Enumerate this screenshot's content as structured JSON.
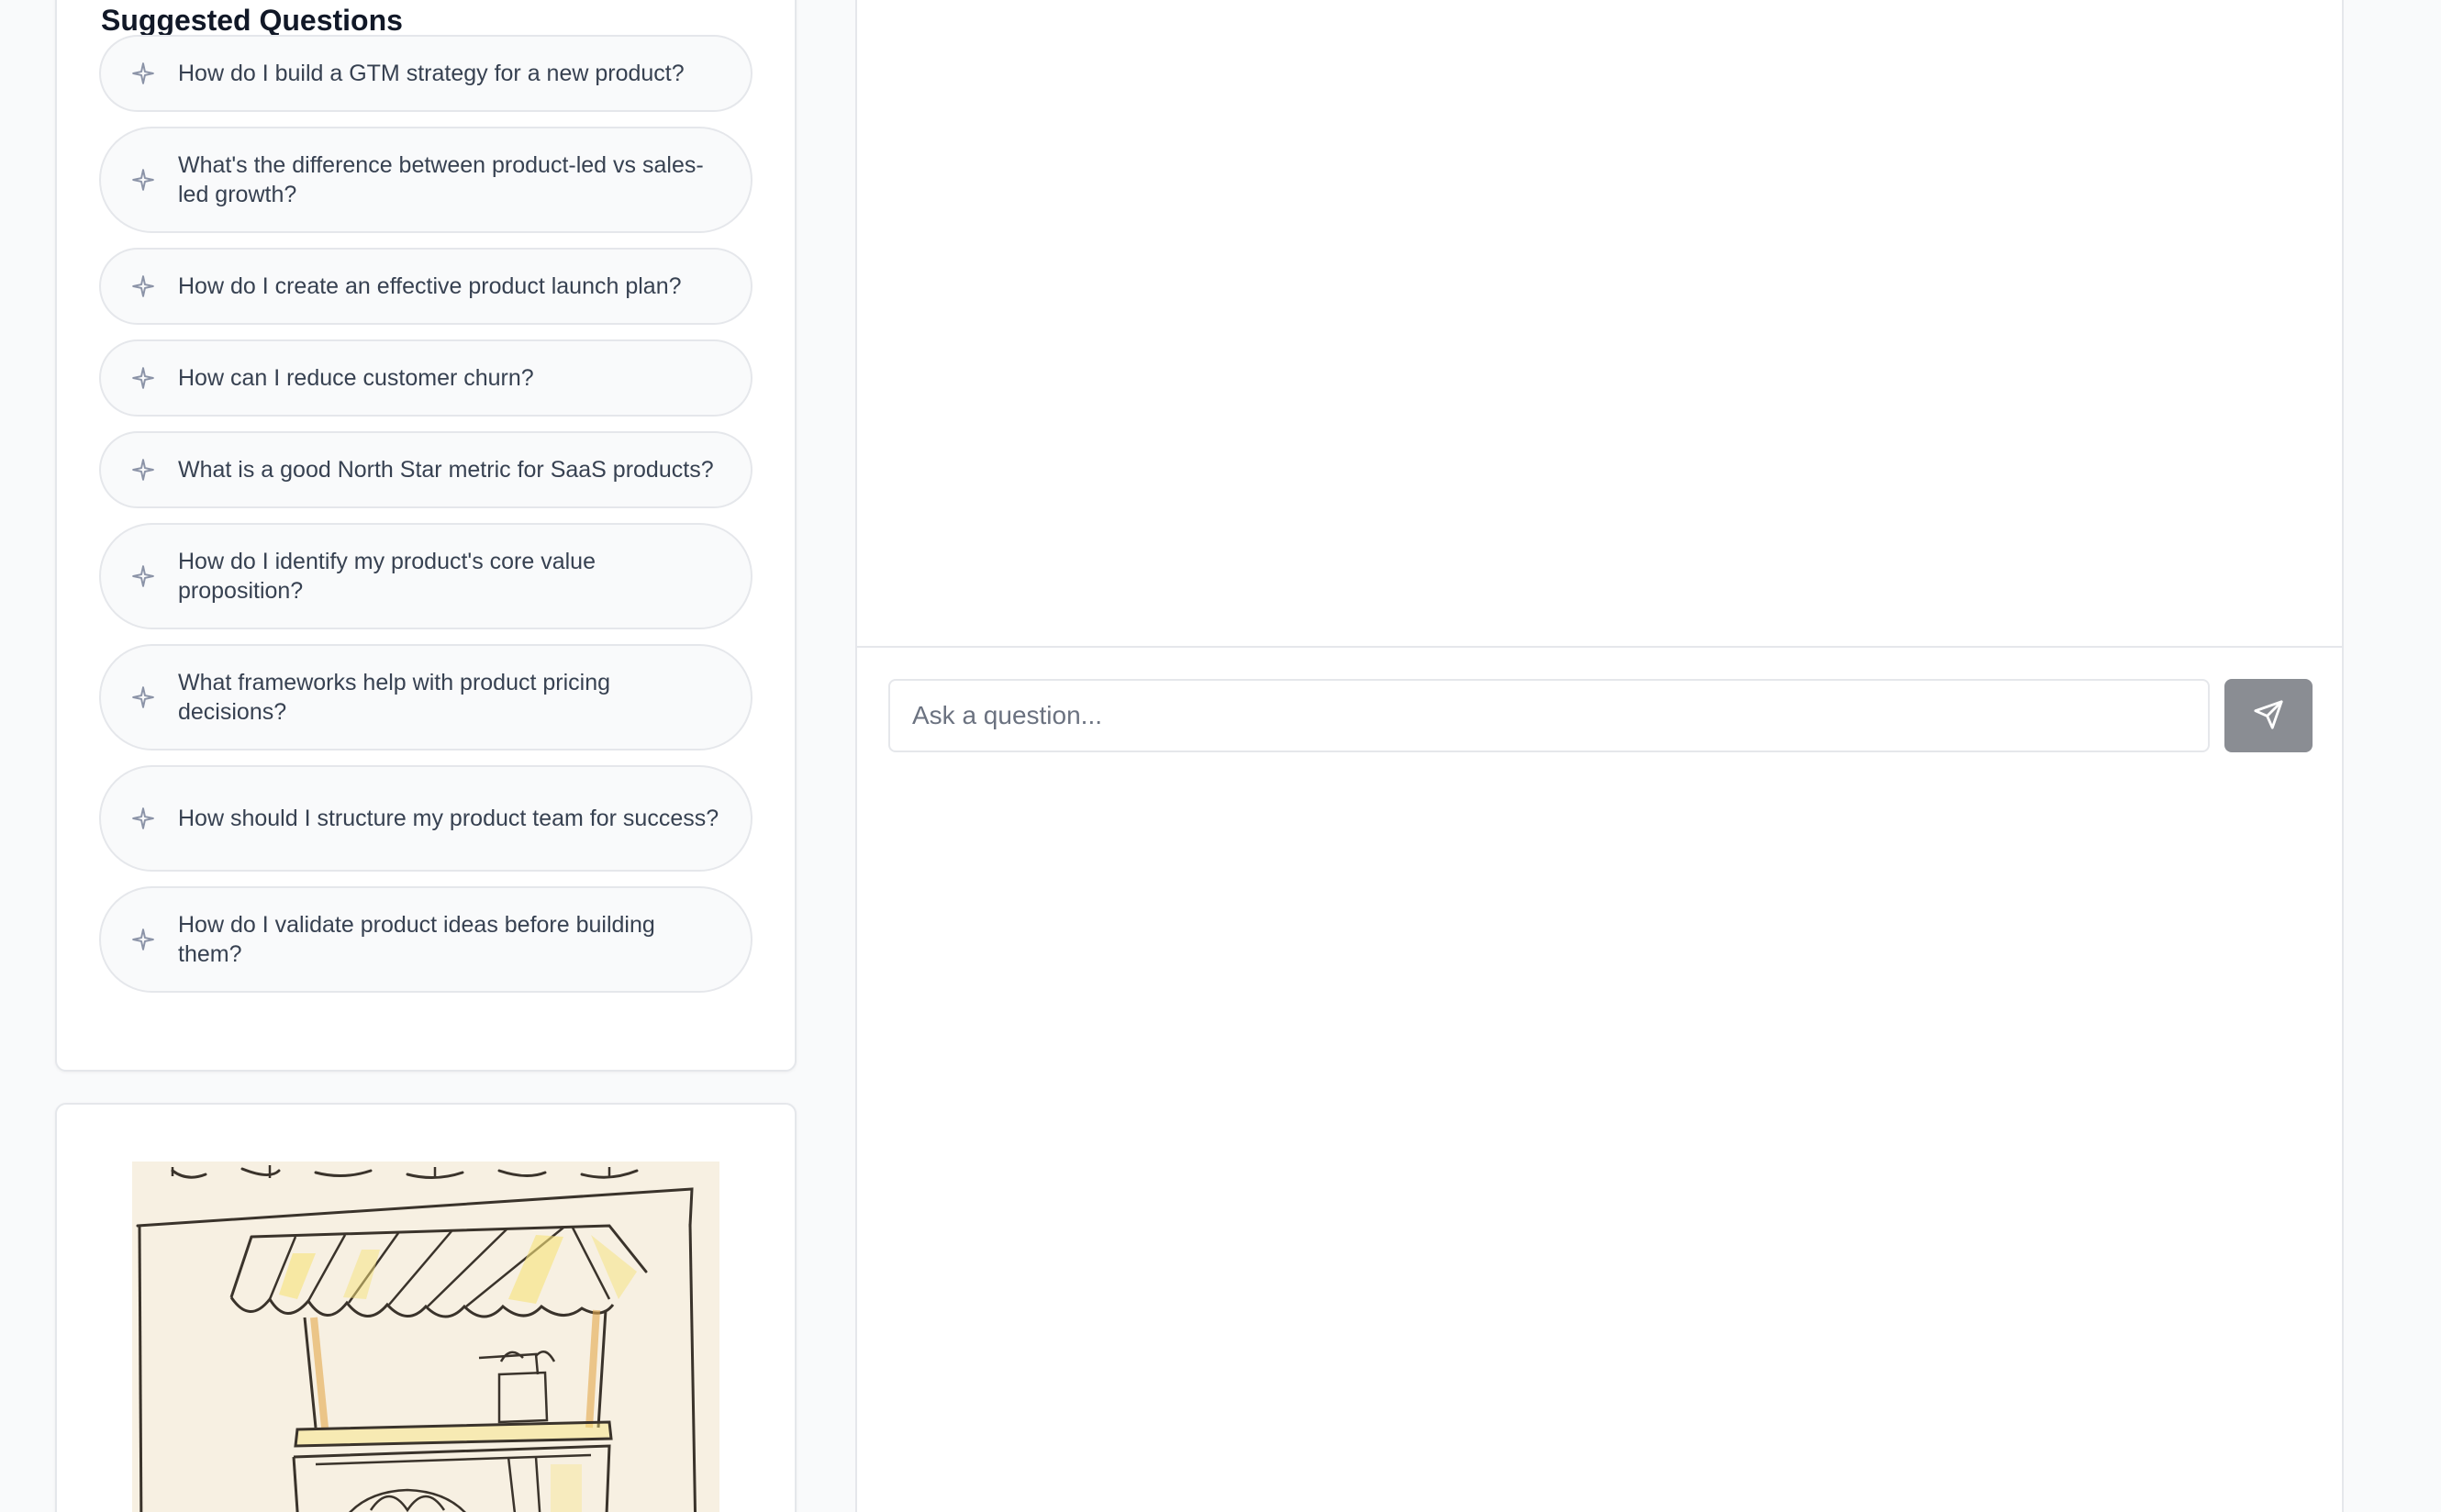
{
  "sidebar": {
    "suggested_title": "Suggested Questions",
    "questions": [
      {
        "label": "How do I build a GTM strategy for a new product?",
        "icon": "sparkle-icon"
      },
      {
        "label": "What's the difference between product-led vs sales-led growth?",
        "icon": "sparkle-icon"
      },
      {
        "label": "How do I create an effective product launch plan?",
        "icon": "sparkle-icon"
      },
      {
        "label": "How can I reduce customer churn?",
        "icon": "sparkle-icon"
      },
      {
        "label": "What is a good North Star metric for SaaS products?",
        "icon": "sparkle-icon"
      },
      {
        "label": "How do I identify my product's core value proposition?",
        "icon": "sparkle-icon"
      },
      {
        "label": "What frameworks help with product pricing decisions?",
        "icon": "sparkle-icon"
      },
      {
        "label": "How should I structure my product team for success?",
        "icon": "sparkle-icon"
      },
      {
        "label": "How do I validate product ideas before building them?",
        "icon": "sparkle-icon"
      }
    ]
  },
  "chat": {
    "input_placeholder": "Ask a question...",
    "input_value": "",
    "send_icon": "send-icon"
  },
  "colors": {
    "background": "#f9fafb",
    "card": "#ffffff",
    "border": "#e5e7eb",
    "pill": "#f9fafb",
    "text": "#374151",
    "sparkle": "#8b93a7",
    "send_button": "#8a8d93"
  }
}
